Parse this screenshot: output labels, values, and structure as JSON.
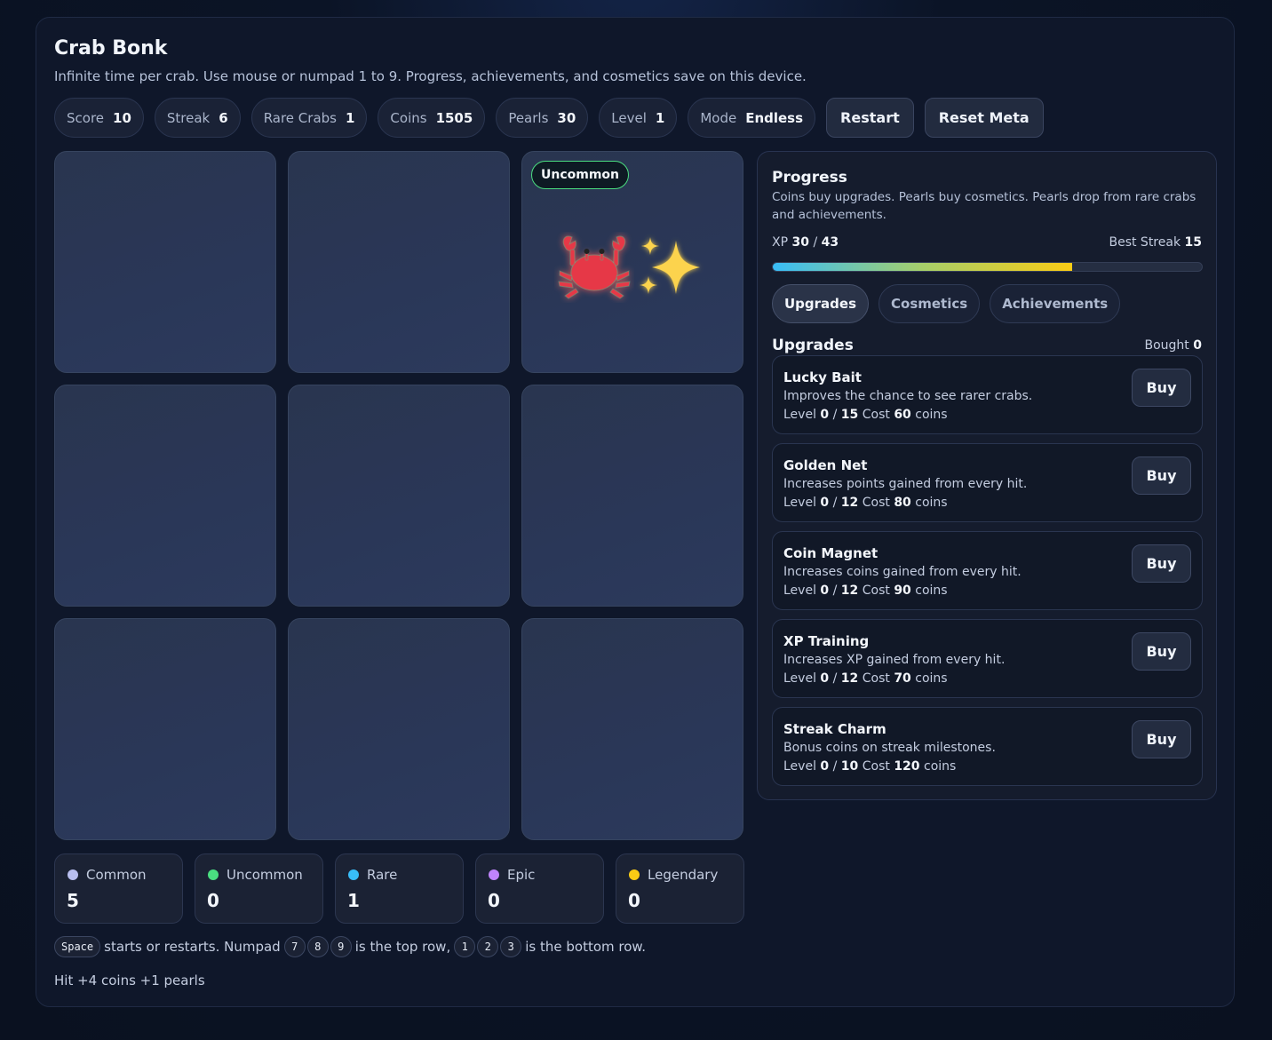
{
  "header": {
    "title": "Crab Bonk",
    "subtitle": "Infinite time per crab. Use mouse or numpad 1 to 9. Progress, achievements, and cosmetics save on this device."
  },
  "stats": [
    {
      "label": "Score",
      "value": "10"
    },
    {
      "label": "Streak",
      "value": "6"
    },
    {
      "label": "Rare Crabs",
      "value": "1"
    },
    {
      "label": "Coins",
      "value": "1505"
    },
    {
      "label": "Pearls",
      "value": "30"
    },
    {
      "label": "Level",
      "value": "1"
    },
    {
      "label": "Mode",
      "value": "Endless"
    }
  ],
  "buttons": {
    "restart": "Restart",
    "reset_meta": "Reset Meta"
  },
  "board": {
    "active_cell": 3,
    "active_badge": "Uncommon",
    "badge_color": "#4ade80"
  },
  "rarities": [
    {
      "name": "Common",
      "count": "5",
      "color": "#b9bff0"
    },
    {
      "name": "Uncommon",
      "count": "0",
      "color": "#4ade80"
    },
    {
      "name": "Rare",
      "count": "1",
      "color": "#38bdf8"
    },
    {
      "name": "Epic",
      "count": "0",
      "color": "#c084fc"
    },
    {
      "name": "Legendary",
      "count": "0",
      "color": "#facc15"
    }
  ],
  "hint": {
    "key_space": "Space",
    "text1": "starts or restarts. Numpad",
    "top_keys": [
      "7",
      "8",
      "9"
    ],
    "text2": "is the top row,",
    "bottom_keys": [
      "1",
      "2",
      "3"
    ],
    "text3": "is the bottom row."
  },
  "footer": "Hit +4 coins +1 pearls",
  "progress": {
    "title": "Progress",
    "description": "Coins buy upgrades. Pearls buy cosmetics. Pearls drop from rare crabs and achievements.",
    "xp_label": "XP",
    "xp_current": "30",
    "xp_sep": "/",
    "xp_max": "43",
    "xp_fraction": 0.698,
    "best_label": "Best Streak",
    "best_value": "15"
  },
  "tabs": [
    {
      "label": "Upgrades",
      "active": true
    },
    {
      "label": "Cosmetics",
      "active": false
    },
    {
      "label": "Achievements",
      "active": false
    }
  ],
  "upgrades": {
    "heading": "Upgrades",
    "bought_label": "Bought",
    "bought_value": "0",
    "buy_label": "Buy",
    "level_label": "Level",
    "cost_label": "Cost",
    "coins_label": "coins",
    "items": [
      {
        "name": "Lucky Bait",
        "desc": "Improves the chance to see rarer crabs.",
        "level": "0",
        "max": "15",
        "cost": "60"
      },
      {
        "name": "Golden Net",
        "desc": "Increases points gained from every hit.",
        "level": "0",
        "max": "12",
        "cost": "80"
      },
      {
        "name": "Coin Magnet",
        "desc": "Increases coins gained from every hit.",
        "level": "0",
        "max": "12",
        "cost": "90"
      },
      {
        "name": "XP Training",
        "desc": "Increases XP gained from every hit.",
        "level": "0",
        "max": "12",
        "cost": "70"
      },
      {
        "name": "Streak Charm",
        "desc": "Bonus coins on streak milestones.",
        "level": "0",
        "max": "10",
        "cost": "120"
      }
    ]
  }
}
